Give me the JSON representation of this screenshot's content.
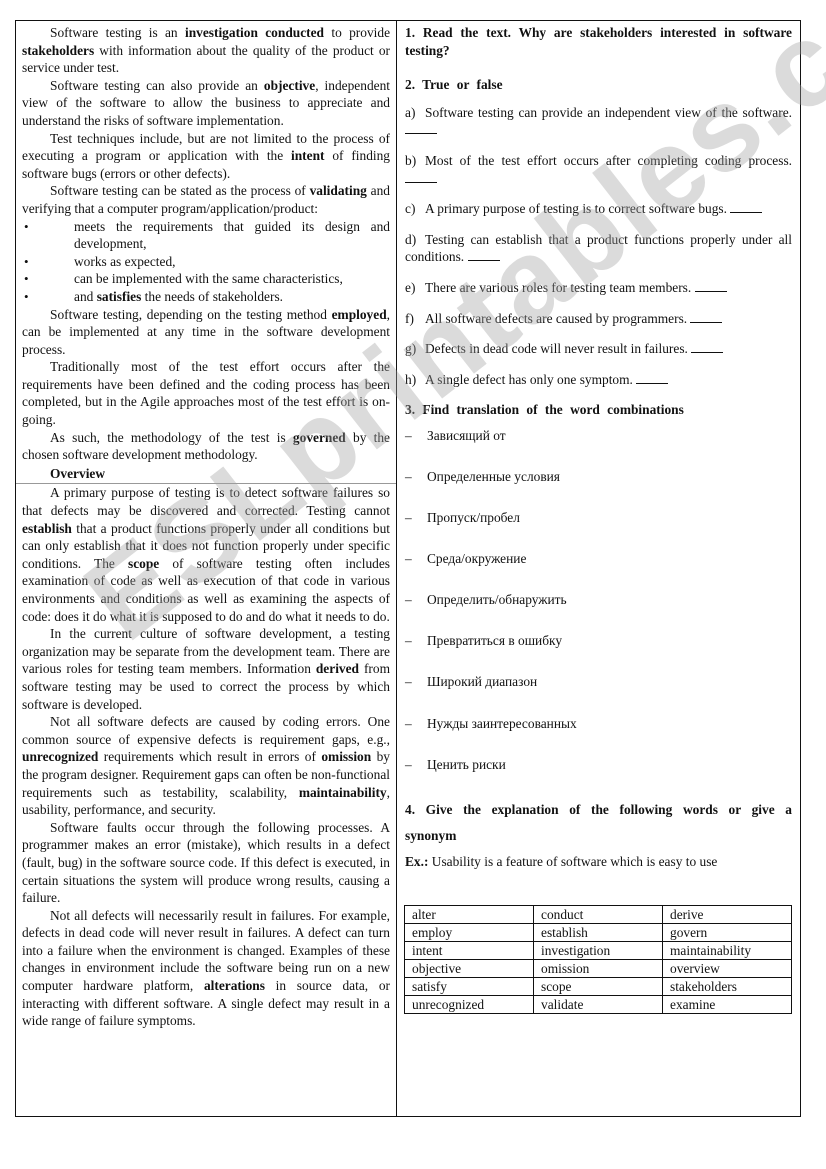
{
  "left_column": {
    "paragraphs_intro": [
      {
        "parts": [
          {
            "t": "Software testing is an "
          },
          {
            "b": "investigation conducted"
          },
          {
            "t": " to provide "
          },
          {
            "b": "stakeholders"
          },
          {
            "t": " with information about the quality of the product or service under test."
          }
        ]
      },
      {
        "parts": [
          {
            "t": "Software testing can also provide an "
          },
          {
            "b": "objective"
          },
          {
            "t": ", independent view of the software to allow the business to appreciate and understand the risks of software implementation."
          }
        ]
      },
      {
        "parts": [
          {
            "t": "Test techniques include, but are not limited to the process of executing a program or application with the "
          },
          {
            "b": "intent"
          },
          {
            "t": " of finding software bugs (errors or other defects)."
          }
        ]
      },
      {
        "parts": [
          {
            "t": "Software testing can be stated as the process of "
          },
          {
            "b": "validating"
          },
          {
            "t": " and verifying that a computer program/application/product:"
          }
        ]
      }
    ],
    "bullets": [
      {
        "parts": [
          {
            "t": "meets the requirements that guided its design and development,"
          }
        ]
      },
      {
        "parts": [
          {
            "t": "works as expected,"
          }
        ]
      },
      {
        "parts": [
          {
            "t": "can be implemented with the same characteristics,"
          }
        ]
      },
      {
        "parts": [
          {
            "t": "and "
          },
          {
            "b": "satisfies"
          },
          {
            "t": " the needs of stakeholders."
          }
        ]
      }
    ],
    "paragraphs_mid": [
      {
        "parts": [
          {
            "t": "Software testing, depending on the testing method "
          },
          {
            "b": "employed"
          },
          {
            "t": ", can be implemented at any time in the software development process."
          }
        ]
      },
      {
        "parts": [
          {
            "t": "Traditionally most of the test effort occurs after the requirements have been defined and the coding process has been completed, but in the Agile approaches most of the test effort is on-going."
          }
        ]
      },
      {
        "parts": [
          {
            "t": "As such, the methodology of the test is "
          },
          {
            "b": "governed"
          },
          {
            "t": " by the chosen software development methodology."
          }
        ]
      }
    ],
    "overview_heading": "Overview",
    "paragraphs_overview": [
      {
        "parts": [
          {
            "t": "A primary purpose of testing is to detect software failures so that defects may be discovered and corrected. Testing cannot "
          },
          {
            "b": "establish"
          },
          {
            "t": " that a product functions properly under all conditions but can only establish that it does not function properly under specific conditions. The "
          },
          {
            "b": "scope"
          },
          {
            "t": " of software testing often includes examination of code as well as execution of that code in various environments and conditions as well as examining the aspects of code: does it do what it is supposed to do and do what it needs to do."
          }
        ]
      },
      {
        "parts": [
          {
            "t": "In the current culture of software development, a testing organization may be separate from the development team. There are various roles for testing team members. Information "
          },
          {
            "b": "derived"
          },
          {
            "t": " from software testing may be used to correct the process by which software is developed."
          }
        ]
      },
      {
        "parts": [
          {
            "t": "Not all software defects are caused by coding errors. One common source of expensive defects is requirement gaps, e.g., "
          },
          {
            "b": "unrecognized"
          },
          {
            "t": " requirements which result in errors of "
          },
          {
            "b": "omission"
          },
          {
            "t": " by the program designer. Requirement gaps can often be non-functional requirements such as testability, scalability, "
          },
          {
            "b": "maintainability"
          },
          {
            "t": ", usability, performance, and security."
          }
        ]
      },
      {
        "parts": [
          {
            "t": "Software faults occur through the following processes. A programmer makes an error (mistake), which results in a defect (fault, bug) in the software source code. If this defect is executed, in certain situations the system will produce wrong results, causing a failure."
          }
        ]
      },
      {
        "parts": [
          {
            "t": "Not all defects will necessarily result in failures. For example, defects in dead code will never result in failures. A defect can turn into a failure when the environment is changed. Examples of these changes in environment include the software being run on a new computer hardware platform, "
          },
          {
            "b": "alterations"
          },
          {
            "t": " in source data, or interacting with different software. A single defect may result in a wide range of failure symptoms."
          }
        ]
      }
    ]
  },
  "right_column": {
    "q1": "1. Read the text. Why are stakeholders interested in software testing?",
    "q2": "2.  True or false",
    "true_false": [
      {
        "label": "a)",
        "text": "Software testing can provide an independent view of the software."
      },
      {
        "label": "b)",
        "text": "Most of the test effort occurs after completing coding process."
      },
      {
        "label": "c)",
        "text": "A primary purpose of testing is to correct software bugs."
      },
      {
        "label": "d)",
        "text": "Testing can establish that a product functions properly under all conditions."
      },
      {
        "label": "e)",
        "text": "There are various roles for testing team members."
      },
      {
        "label": "f)",
        "text": "All software defects are caused by programmers."
      },
      {
        "label": "g)",
        "text": "Defects in dead code will never result in failures."
      },
      {
        "label": "h)",
        "text": "A single defect has only one symptom."
      }
    ],
    "q3": "3. Find translation of the word combinations",
    "dash": "–",
    "translations": [
      "Зависящий от",
      "Определенные условия",
      "Пропуск/пробел",
      "Среда/окружение",
      "Определить/обнаружить",
      "Превратиться в ошибку",
      "Широкий диапазон",
      "Нужды заинтересованных",
      "Ценить риски"
    ],
    "q4": "4. Give the explanation of the following words or give a synonym",
    "example_label": "Ex.:",
    "example_text": " Usability is a feature of software which is easy to use",
    "word_table": [
      [
        "alter",
        "conduct",
        "derive"
      ],
      [
        "employ",
        "establish",
        "govern"
      ],
      [
        "intent",
        "investigation",
        "maintainability"
      ],
      [
        "objective",
        "omission",
        "overview"
      ],
      [
        "satisfy",
        "scope",
        "stakeholders"
      ],
      [
        "unrecognized",
        "validate",
        "examine"
      ]
    ]
  },
  "watermark": "ESLprintables.com"
}
